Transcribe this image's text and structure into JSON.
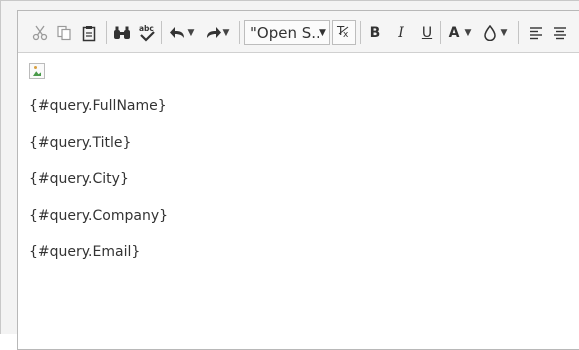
{
  "toolbar": {
    "font_family_value": "\"Open S...",
    "bold_label": "B",
    "italic_label": "I",
    "underline_label": "U",
    "font_color_label": "A",
    "icons": [
      "cut-icon",
      "copy-icon",
      "paste-icon",
      "find-icon",
      "spellcheck-icon",
      "undo-icon",
      "redo-icon",
      "clear-formatting-icon",
      "font-color-icon",
      "highlight-color-icon",
      "align-left-icon",
      "align-center-icon"
    ]
  },
  "content": {
    "image_alt": "",
    "fields": [
      "{#query.FullName}",
      "{#query.Title}",
      "{#query.City}",
      "{#query.Company}",
      "{#query.Email}"
    ]
  }
}
